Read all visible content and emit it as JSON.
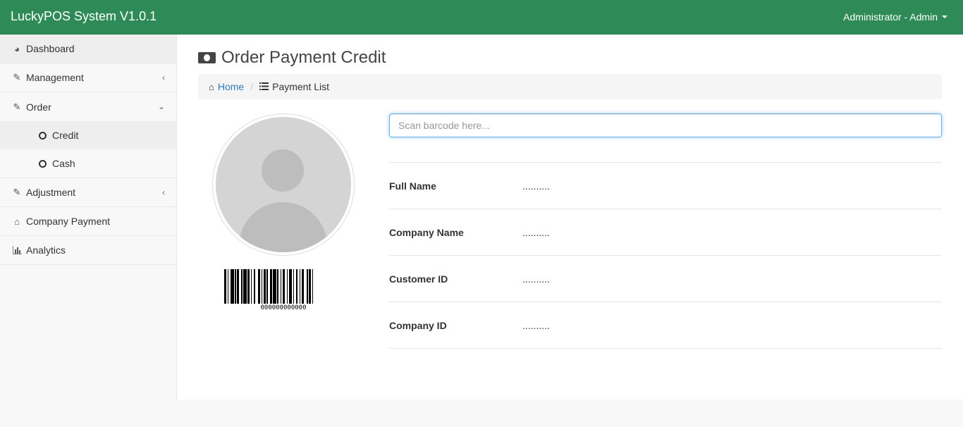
{
  "navbar": {
    "brand": "LuckyPOS System V1.0.1",
    "user": "Administrator - Admin"
  },
  "sidebar": {
    "items": [
      {
        "label": "Dashboard",
        "icon": "dashboard-icon"
      },
      {
        "label": "Management",
        "icon": "edit-icon"
      },
      {
        "label": "Order",
        "icon": "edit-icon"
      },
      {
        "label": "Adjustment",
        "icon": "edit-icon"
      },
      {
        "label": "Company Payment",
        "icon": "home-icon"
      },
      {
        "label": "Analytics",
        "icon": "bar-chart-icon"
      }
    ],
    "order_sub": [
      {
        "label": "Credit"
      },
      {
        "label": "Cash"
      }
    ]
  },
  "page": {
    "title": "Order Payment Credit",
    "icon": "money-icon"
  },
  "breadcrumb": {
    "home": "Home",
    "current": "Payment List"
  },
  "scan": {
    "placeholder": "Scan barcode here..."
  },
  "barcode": {
    "text": "000000000000"
  },
  "info": {
    "rows": [
      {
        "label": "Full Name",
        "value": ".........."
      },
      {
        "label": "Company Name",
        "value": ".........."
      },
      {
        "label": "Customer ID",
        "value": ".........."
      },
      {
        "label": "Company ID",
        "value": ".........."
      }
    ]
  },
  "colors": {
    "navbar": "#2e8b57",
    "link": "#337ab7"
  }
}
